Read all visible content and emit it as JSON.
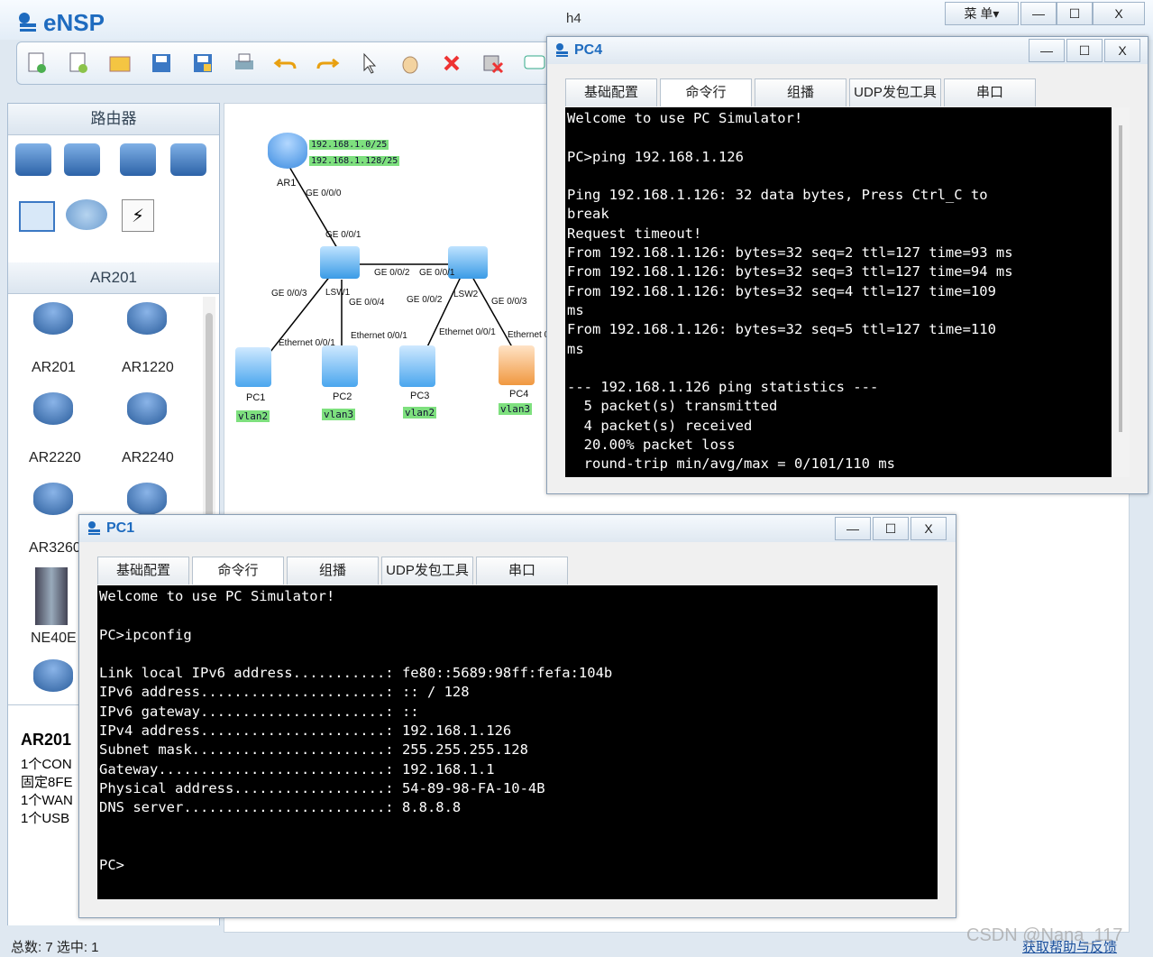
{
  "app": {
    "name": "eNSP",
    "window_title": "h4",
    "menu_label": "菜 单▾",
    "minimize": "—",
    "maximize": "☐",
    "close": "X"
  },
  "toolbar": {
    "icons": [
      "new-topology-icon",
      "new-lab-icon",
      "open-icon",
      "save-icon",
      "save-as-icon",
      "print-icon",
      "undo-icon",
      "redo-icon",
      "select-icon",
      "pan-hand-icon",
      "delete-icon",
      "delete-link-icon",
      "text-icon"
    ]
  },
  "left_panel": {
    "section1_title": "路由器",
    "section2_title": "AR201",
    "devices": [
      {
        "label": "AR201"
      },
      {
        "label": "AR1220"
      },
      {
        "label": "AR2220"
      },
      {
        "label": "AR2240"
      },
      {
        "label": "AR3260"
      },
      {
        "label": "NE40E"
      }
    ],
    "info_title": "AR201",
    "info_lines": [
      "1个CON",
      "固定8FE",
      "1个WAN",
      "1个USB"
    ]
  },
  "topology": {
    "router": {
      "name": "AR1",
      "routes": [
        "192.168.1.0/25",
        "192.168.1.128/25"
      ],
      "port": "GE 0/0/0"
    },
    "switches": [
      {
        "name": "LSW1",
        "ports": [
          "GE 0/0/1",
          "GE 0/0/2",
          "GE 0/0/3",
          "GE 0/0/4"
        ]
      },
      {
        "name": "LSW2",
        "ports": [
          "GE 0/0/1",
          "GE 0/0/2",
          "GE 0/0/3"
        ]
      }
    ],
    "pcs": [
      {
        "name": "PC1",
        "port": "Ethernet 0/0/1",
        "vlan": "vlan2"
      },
      {
        "name": "PC2",
        "port": "Ethernet 0/0/1",
        "vlan": "vlan3"
      },
      {
        "name": "PC3",
        "port": "Ethernet 0/0/1",
        "vlan": "vlan2"
      },
      {
        "name": "PC4",
        "port": "Ethernet 0",
        "vlan": "vlan3"
      }
    ]
  },
  "pc4_window": {
    "title": "PC4",
    "tabs": [
      "基础配置",
      "命令行",
      "组播",
      "UDP发包工具",
      "串口"
    ],
    "active_tab": "命令行",
    "lines": [
      "Welcome to use PC Simulator!",
      "",
      "PC>ping 192.168.1.126",
      "",
      "Ping 192.168.1.126: 32 data bytes, Press Ctrl_C to",
      "break",
      "Request timeout!",
      "From 192.168.1.126: bytes=32 seq=2 ttl=127 time=93 ms",
      "From 192.168.1.126: bytes=32 seq=3 ttl=127 time=94 ms",
      "From 192.168.1.126: bytes=32 seq=4 ttl=127 time=109",
      "ms",
      "From 192.168.1.126: bytes=32 seq=5 ttl=127 time=110",
      "ms",
      "",
      "--- 192.168.1.126 ping statistics ---",
      "  5 packet(s) transmitted",
      "  4 packet(s) received",
      "  20.00% packet loss",
      "  round-trip min/avg/max = 0/101/110 ms"
    ]
  },
  "pc1_window": {
    "title": "PC1",
    "tabs": [
      "基础配置",
      "命令行",
      "组播",
      "UDP发包工具",
      "串口"
    ],
    "active_tab": "命令行",
    "lines": [
      "Welcome to use PC Simulator!",
      "",
      "PC>ipconfig",
      "",
      "Link local IPv6 address...........: fe80::5689:98ff:fefa:104b",
      "IPv6 address......................: :: / 128",
      "IPv6 gateway......................: ::",
      "IPv4 address......................: 192.168.1.126",
      "Subnet mask.......................: 255.255.255.128",
      "Gateway...........................: 192.168.1.1",
      "Physical address..................: 54-89-98-FA-10-4B",
      "DNS server........................: 8.8.8.8",
      "",
      "",
      "PC>"
    ]
  },
  "status": {
    "text": "总数: 7 选中: 1",
    "help_link": "获取帮助与反馈",
    "watermark": "CSDN @Nana_117"
  },
  "colors": {
    "accent": "#1e6bbf",
    "vlan_tag": "#7ee07e",
    "terminal_bg": "#000000"
  }
}
